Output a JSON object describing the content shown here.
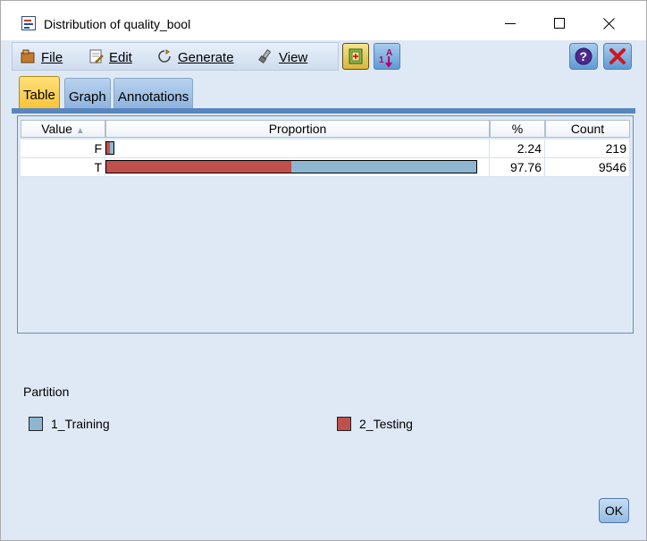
{
  "window": {
    "title": "Distribution of quality_bool"
  },
  "menu": {
    "file": "File",
    "edit": "Edit",
    "generate": "Generate",
    "view": "View"
  },
  "tabs": [
    {
      "label": "Table",
      "active": true
    },
    {
      "label": "Graph",
      "active": false
    },
    {
      "label": "Annotations",
      "active": false
    }
  ],
  "table": {
    "headers": [
      "Value",
      "Proportion",
      "%",
      "Count"
    ],
    "sort_indicator": "▲",
    "rows": [
      {
        "value": "F",
        "percent": "2.24",
        "count": "219",
        "proportion": 0.0224,
        "testing_fraction": 0.5
      },
      {
        "value": "T",
        "percent": "97.76",
        "count": "9546",
        "proportion": 0.9776,
        "testing_fraction": 0.5
      }
    ]
  },
  "partition": {
    "label": "Partition",
    "items": [
      {
        "label": "1_Training",
        "color": "#8fb6d0"
      },
      {
        "label": "2_Testing",
        "color": "#c0504d"
      }
    ]
  },
  "ok_label": "OK",
  "colors": {
    "training": "#8fb6d0",
    "testing": "#c0504d",
    "tab_active": "#f7c43a"
  }
}
